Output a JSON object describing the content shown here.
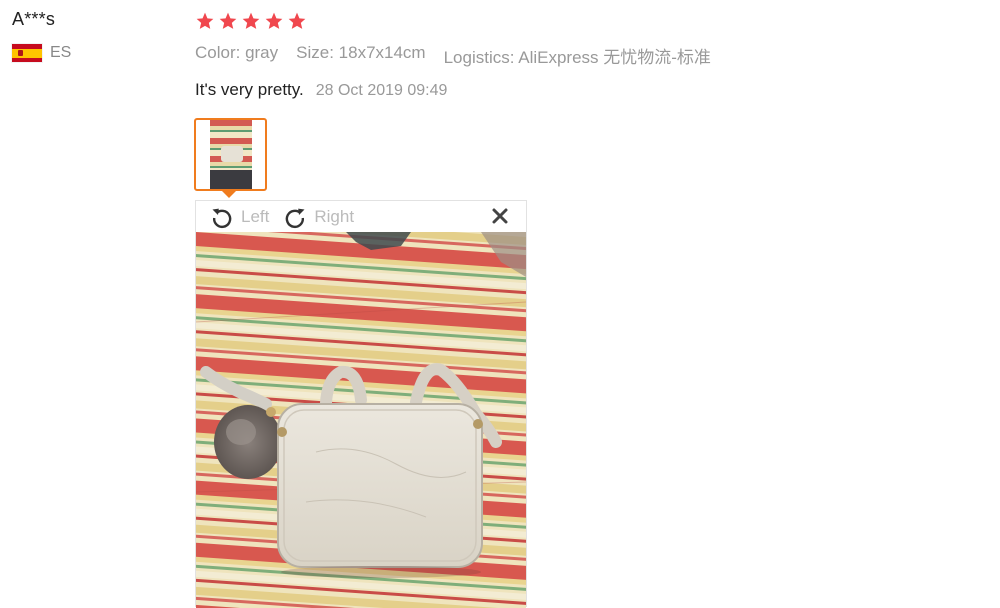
{
  "reviewer": {
    "name": "A***s",
    "country_code": "ES"
  },
  "review": {
    "rating": 5,
    "star_color": "#f0474e",
    "color_label": "Color: gray",
    "size_label": "Size: 18x7x14cm",
    "logistics_label": "Logistics: AliExpress 无忧物流-标准",
    "text": "It's very pretty.",
    "date": "28 Oct 2019 09:49"
  },
  "viewer": {
    "rotate_left_label": "Left",
    "rotate_right_label": "Right"
  },
  "colors": {
    "accent": "#f07c1e",
    "muted_text": "#999999"
  }
}
